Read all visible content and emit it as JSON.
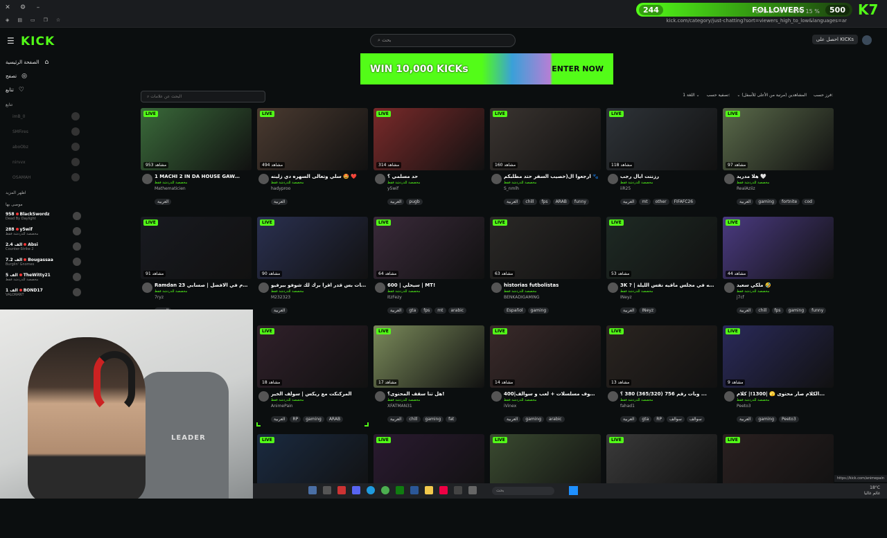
{
  "browser": {
    "url": "kick.com/category/just-chatting?sort=viewers_high_to_low&languages=ar",
    "status_url": "https://kick.com/animepain"
  },
  "overlay": {
    "left_count": "244",
    "label": "FOLLOWERS",
    "right_count": "500",
    "gpu": "GPU 27 %",
    "cpu": "CPU 15 %",
    "brand": "K7"
  },
  "header": {
    "logo": "KICK",
    "search_placeholder": "بحث",
    "get_kicks": "احصل على KICKs"
  },
  "banner": {
    "title": "WIN 10,000 KICKs",
    "cta": "ENTER NOW"
  },
  "sidebar": {
    "nav": [
      {
        "label": "الصفحة الرئيسية",
        "icon": "home-icon",
        "glyph": "⌂"
      },
      {
        "label": "تصفح",
        "icon": "compass-icon",
        "glyph": "◎"
      },
      {
        "label": "تتابع",
        "icon": "heart-icon",
        "glyph": "♡"
      }
    ],
    "following_title": "تتابع",
    "following": [
      "imB_0",
      "SMFires",
      "aboObz",
      "nirvvx",
      "OSAMAH"
    ],
    "show_more": "اظهر المزيد",
    "recommended_title": "موصى بها",
    "recommended": [
      {
        "count": "958",
        "name": "BlackSwordz",
        "sub": "Dead By Daylight"
      },
      {
        "count": "288",
        "name": "y5wif",
        "sub": "مخصصة للدردشة فقط"
      },
      {
        "count": "الف 2.4",
        "name": "Absi",
        "sub": "Counter-Strike 2"
      },
      {
        "count": "الف 7.2",
        "name": "Bougassaa",
        "sub": "Burglin' Gnomes"
      },
      {
        "count": "الف 5",
        "name": "TheWitty21",
        "sub": "مخصصة للدردشة فقط"
      },
      {
        "count": "الف 1",
        "name": "BOND17",
        "sub": "VALORANT"
      }
    ]
  },
  "filters": {
    "tag_search_placeholder": "البحث عن علامات",
    "sort_label": "فرز حسب:",
    "sort_value": "المشاهدين (مرتبة من الأعلى للأسفل)",
    "filter_label": "تصفية حسب:",
    "language": "اللغة",
    "language_count": "1"
  },
  "common": {
    "live": "LIVE",
    "category": "مخصصة للدردشة فقط"
  },
  "streams": [
    {
      "viewers": "953 مشاهد",
      "title": "1 MACHI 2 IN DA HOUSE GAW…",
      "user": "Mathematicien",
      "tags": [
        "العربية"
      ],
      "bg": "#3a6a3a"
    },
    {
      "viewers": "494 مشاهد",
      "title": "سلي وتعالى السهره دي زلينه 🤩 ❤️",
      "user": "hadyproo",
      "tags": [
        "العربية"
      ],
      "bg": "#4a3a30"
    },
    {
      "viewers": "314 مشاهد",
      "title": "حد مسلمي ؟",
      "user": "y5wif",
      "tags": [
        "العربية",
        "pugb"
      ],
      "bg": "#7a2a2a"
    },
    {
      "viewers": "160 مشاهد",
      "title": "ارجعوا ال(خصيب السفر حتد مطلبكم 🐾",
      "user": "S_nmlh",
      "tags": [
        "العربية",
        "chill",
        "fps",
        "ARAB",
        "funny"
      ],
      "bg": "#3a3430"
    },
    {
      "viewers": "118 مشاهد",
      "title": "رزننت ايال رجب",
      "user": "iiR25",
      "tags": [
        "العربية",
        "mt",
        "other",
        "FIFAFC26"
      ],
      "bg": "#2e3338"
    },
    {
      "viewers": "97 مشاهد",
      "title": "هلا مدريد 🤍",
      "user": "RealAziiz",
      "tags": [
        "العربية",
        "gaming",
        "fortnite",
        "cod"
      ],
      "bg": "#5a6a4a"
    },
    {
      "viewers": "91 مشاهد",
      "title": "Ramdan 23 بلس | لما يوم في الافضل | صسابي...",
      "user": "7ryz",
      "tags": [
        "العربية"
      ],
      "bg": "#181a20"
    },
    {
      "viewers": "90 مشاهد",
      "title": "الجهات بس قدر اقرا برك لك شوفو بيرفيو ...",
      "user": "M232323",
      "tags": [
        "العربية"
      ],
      "bg": "#2a3050"
    },
    {
      "viewers": "64 مشاهد",
      "title": "سيحلي | 600 | MT!",
      "user": "ItzFezy",
      "tags": [
        "العربية",
        "gta",
        "fps",
        "mt",
        "arabic"
      ],
      "bg": "#3a2a3a"
    },
    {
      "viewers": "63 مشاهد",
      "title": "historias futbolistas",
      "user": "BENKADIGAMING",
      "tags": [
        "Español",
        "gaming"
      ],
      "bg": "#2a2826"
    },
    {
      "viewers": "53 مشاهد",
      "title": "3K ? | حيكم الله في مجلس ماقيه نفس الليلة",
      "user": "INeyz",
      "tags": [
        "العربية",
        "INeyz"
      ],
      "bg": "#1e2a24"
    },
    {
      "viewers": "44 مشاهد",
      "title": "ملكي سعيد 🤣",
      "user": "j7cf",
      "tags": [
        "العربية",
        "chill",
        "fps",
        "gaming",
        "funny"
      ],
      "bg": "#4a3a80"
    },
    {
      "viewers": "18 مشاهد",
      "title": "المركنكت مع ريكس | سولف الخير",
      "user": "AnimePain",
      "tags": [
        "العربية",
        "RP",
        "gaming",
        "ARAB"
      ],
      "bg": "#30202a"
    },
    {
      "viewers": "17 مشاهد",
      "title": "هل تنا سقف المحتوى؟!",
      "user": "XFATMAN31",
      "tags": [
        "العربية",
        "chill",
        "gaming",
        "fat"
      ],
      "bg": "#7a8a5a"
    },
    {
      "viewers": "14 مشاهد",
      "title": "400|شوف مسلسلات + لعب و سوالف ...",
      "user": "iVinex",
      "tags": [
        "العربية",
        "gaming",
        "arabic"
      ],
      "bg": "#3a2a2a"
    },
    {
      "viewers": "13 مشاهد",
      "title": "وبات رقم 756 (365/320) 380 ؟ ...",
      "user": "fahad1",
      "tags": [
        "العربية",
        "gta",
        "RP",
        "سوالف",
        "سوالف"
      ],
      "bg": "#2a2420"
    },
    {
      "viewers": "9 مشاهد",
      "title": "الكلام صار محتوى 🫣 |1300!| كلام...",
      "user": "Peeto3",
      "tags": [
        "العربية",
        "gaming",
        "Peeto3"
      ],
      "bg": "#2a2a5a"
    },
    {
      "viewers": "",
      "title": "",
      "user": "",
      "tags": [],
      "bg": "#1a2a40"
    },
    {
      "viewers": "",
      "title": "",
      "user": "",
      "tags": [],
      "bg": "#2a1a30"
    },
    {
      "viewers": "",
      "title": "",
      "user": "",
      "tags": [],
      "bg": "#3a4a30"
    },
    {
      "viewers": "",
      "title": "",
      "user": "",
      "tags": [],
      "bg": "#3a3a3a"
    },
    {
      "viewers": "",
      "title": "",
      "user": "",
      "tags": [],
      "bg": "#2a2020"
    }
  ],
  "webcam": {
    "logo": "LEADER"
  },
  "taskbar": {
    "search": "بحث",
    "weather": "18°C",
    "weather_sub": "غائم غالبا"
  }
}
